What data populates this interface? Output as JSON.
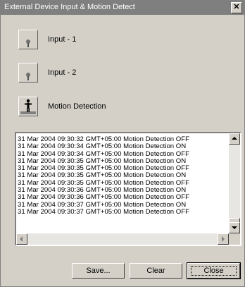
{
  "window": {
    "title": "External Device Input & Motion Detect",
    "close_symbol": "✕"
  },
  "devices": [
    {
      "label": "Input - 1",
      "icon": "input-sensor-icon"
    },
    {
      "label": "Input - 2",
      "icon": "input-sensor-icon"
    },
    {
      "label": "Motion Detection",
      "icon": "person-motion-icon"
    }
  ],
  "log": [
    "31 Mar 2004  09:30:32  GMT+05:00  Motion Detection OFF",
    "31 Mar 2004  09:30:34  GMT+05:00  Motion Detection ON",
    "31 Mar 2004  09:30:34  GMT+05:00  Motion Detection OFF",
    "31 Mar 2004  09:30:35  GMT+05:00  Motion Detection ON",
    "31 Mar 2004  09:30:35  GMT+05:00  Motion Detection OFF",
    "31 Mar 2004  09:30:35  GMT+05:00  Motion Detection ON",
    "31 Mar 2004  09:30:35  GMT+05:00  Motion Detection OFF",
    "31 Mar 2004  09:30:36  GMT+05:00  Motion Detection ON",
    "31 Mar 2004  09:30:36  GMT+05:00  Motion Detection OFF",
    "31 Mar 2004  09:30:37  GMT+05:00  Motion Detection ON",
    "31 Mar 2004  09:30:37  GMT+05:00  Motion Detection OFF"
  ],
  "buttons": {
    "save": "Save...",
    "clear": "Clear",
    "close": "Close"
  }
}
